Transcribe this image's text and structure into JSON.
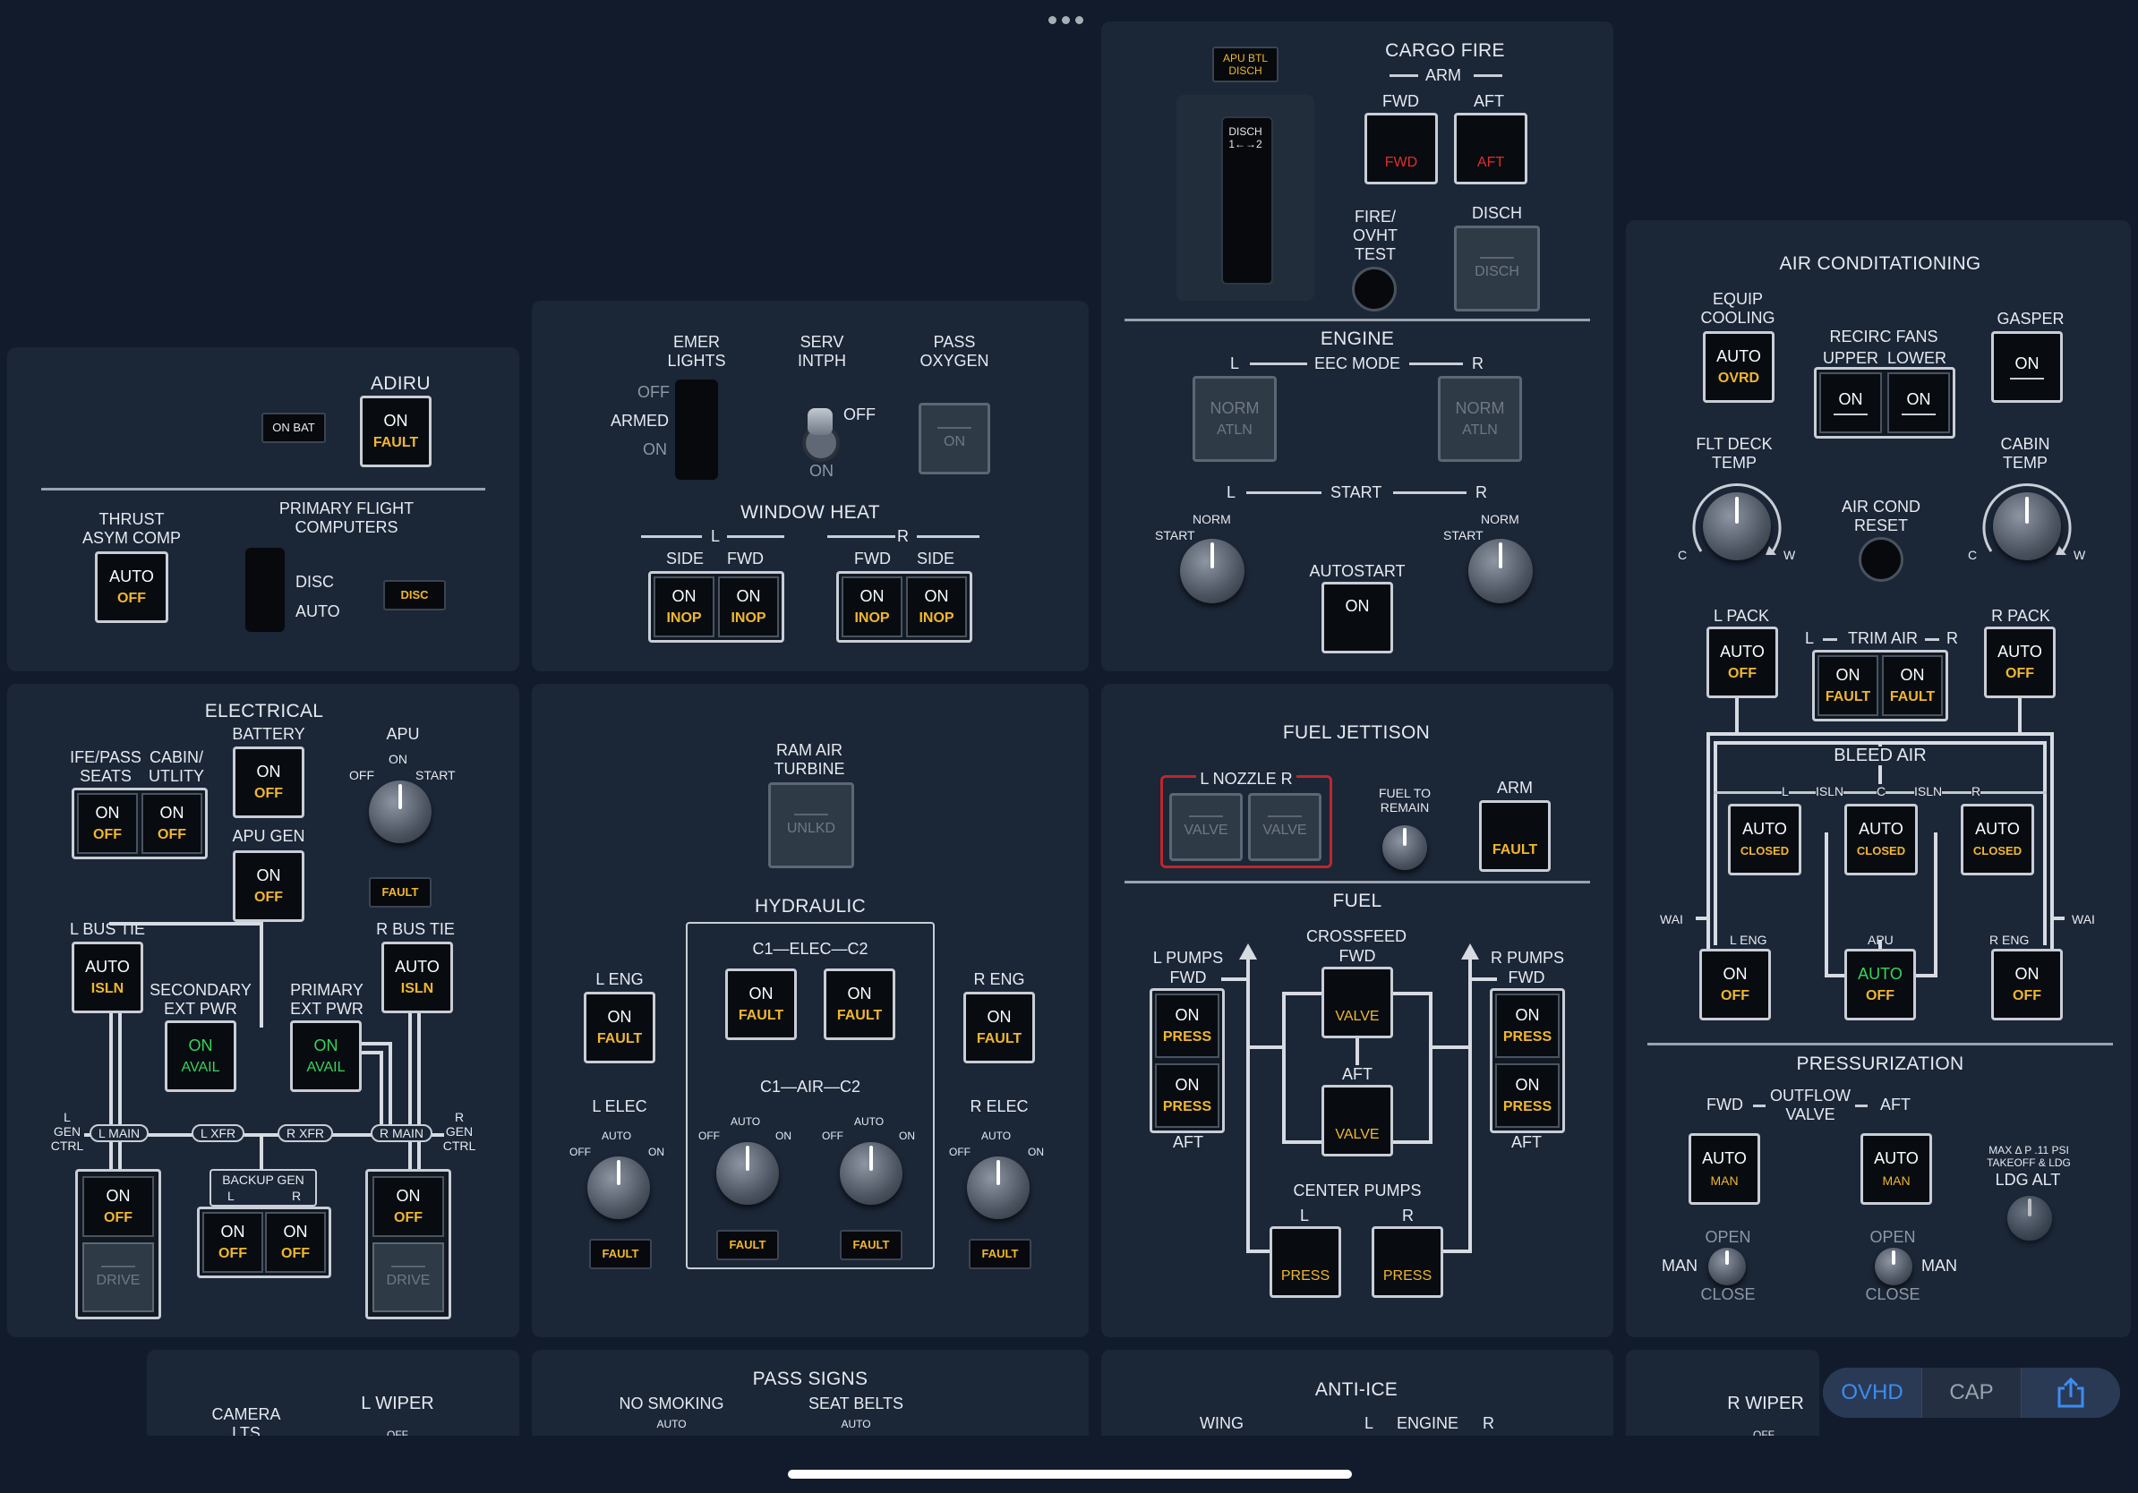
{
  "colors": {
    "background": "#121b2b",
    "panel": "#1b2637",
    "amber": "#f0b630",
    "green": "#39d35c",
    "red": "#e22c2c",
    "accent": "#3d8cf0"
  },
  "adiru": {
    "title": "ADIRU",
    "on_bat": "ON BAT",
    "btn_top": "ON",
    "btn_bot": "FAULT"
  },
  "thrust": {
    "title": "THRUST\nASYM COMP",
    "top": "AUTO",
    "bot": "OFF"
  },
  "pfc": {
    "title": "PRIMARY FLIGHT\nCOMPUTERS",
    "disc": "DISC",
    "auto": "AUTO",
    "lamp": "DISC"
  },
  "emer": {
    "title": "EMER\nLIGHTS",
    "off": "OFF",
    "armed": "ARMED",
    "on": "ON"
  },
  "serv": {
    "title": "SERV\nINTPH",
    "off": "OFF",
    "on": "ON"
  },
  "pass_oxy": {
    "title": "PASS\nOXYGEN",
    "bot": "ON"
  },
  "window_heat": {
    "title": "WINDOW HEAT",
    "l": "L",
    "r": "R",
    "side": "SIDE",
    "fwd": "FWD",
    "on": "ON",
    "inop": "INOP"
  },
  "cargo": {
    "title": "CARGO FIRE",
    "arm": "ARM",
    "fwd": "FWD",
    "aft": "AFT",
    "apu_btl": "APU BTL\nDISCH",
    "disch_slot": "DISCH\n1←→2",
    "fire_test": "FIRE/\nOVHT\nTEST",
    "disch": "DISCH"
  },
  "engine": {
    "title": "ENGINE",
    "eec": "EEC MODE",
    "l": "L",
    "r": "R",
    "norm": "NORM",
    "altn": "ATLN",
    "start": "START",
    "knob_norm": "NORM",
    "knob_start": "START",
    "autostart": "AUTOSTART",
    "on": "ON"
  },
  "aircond": {
    "title": "AIR CONDITATIONING",
    "equip": "EQUIP\nCOOLING",
    "auto": "AUTO",
    "ovrd": "OVRD",
    "recirc": "RECIRC FANS",
    "upper": "UPPER",
    "lower": "LOWER",
    "on": "ON",
    "gasper": "GASPER",
    "flt_deck": "FLT DECK\nTEMP",
    "cabin_temp": "CABIN\nTEMP",
    "c": "C",
    "w": "W",
    "reset": "AIR COND\nRESET",
    "l_pack": "L PACK",
    "r_pack": "R PACK",
    "trim": "TRIM AIR",
    "off": "OFF",
    "fault": "FAULT",
    "l": "L",
    "r": "R"
  },
  "bleed": {
    "title": "BLEED AIR",
    "l": "L",
    "isln": "ISLN",
    "c": "C",
    "r": "R",
    "auto": "AUTO",
    "closed": "CLOSED",
    "wai": "WAI",
    "l_eng": "L ENG",
    "apu": "APU",
    "r_eng": "R ENG",
    "on": "ON",
    "off": "OFF"
  },
  "press": {
    "title": "PRESSURIZATION",
    "fwd": "FWD",
    "aft": "AFT",
    "outflow": "OUTFLOW\nVALVE",
    "auto": "AUTO",
    "man": "MAN",
    "max": "MAX Δ P .11 PSI\nTAKEOFF & LDG",
    "ldg": "LDG ALT",
    "open": "OPEN",
    "close": "CLOSE"
  },
  "electrical": {
    "title": "ELECTRICAL",
    "battery": "BATTERY",
    "ife": "IFE/PASS\nSEATS",
    "cabin": "CABIN/\nUTLITY",
    "apu": "APU",
    "apu_on": "ON",
    "apu_off": "OFF",
    "apu_start": "START",
    "apu_gen": "APU GEN",
    "fault": "FAULT",
    "l_bus": "L BUS TIE",
    "r_bus": "R BUS TIE",
    "auto": "AUTO",
    "isln": "ISLN",
    "sec": "SECONDARY\nEXT PWR",
    "pri": "PRIMARY\nEXT PWR",
    "on": "ON",
    "off": "OFF",
    "avail": "AVAIL",
    "l_gen": "L\nGEN\nCTRL",
    "r_gen": "R\nGEN\nCTRL",
    "l_main": "L MAIN",
    "l_xfr": "L XFR",
    "r_xfr": "R XFR",
    "r_main": "R MAIN",
    "backup": "BACKUP GEN",
    "bl": "L",
    "br": "R",
    "drive": "DRIVE"
  },
  "ram": {
    "title": "RAM AIR\nTURBINE",
    "bot": "UNLKD"
  },
  "hyd": {
    "title": "HYDRAULIC",
    "c1elec": "C1—ELEC—C2",
    "c1air": "C1—AIR—C2",
    "l_eng": "L ENG",
    "r_eng": "R ENG",
    "l_elec": "L ELEC",
    "r_elec": "R ELEC",
    "on": "ON",
    "fault": "FAULT",
    "auto": "AUTO",
    "off": "OFF"
  },
  "jett": {
    "title": "FUEL JETTISON",
    "nozzle": "L NOZZLE R",
    "valve": "VALVE",
    "remain": "FUEL TO\nREMAIN",
    "arm": "ARM",
    "fault": "FAULT"
  },
  "fuel": {
    "title": "FUEL",
    "crossfeed": "CROSSFEED",
    "fwd": "FWD",
    "aft": "AFT",
    "l_pumps": "L PUMPS",
    "r_pumps": "R PUMPS",
    "on": "ON",
    "press": "PRESS",
    "valve": "VALVE",
    "center": "CENTER PUMPS",
    "l": "L",
    "r": "R"
  },
  "bottom": {
    "camera": "CAMERA\nLTS",
    "l_wiper": "L WIPER",
    "pass_signs": "PASS SIGNS",
    "no_smoking": "NO SMOKING",
    "seat_belts": "SEAT BELTS",
    "auto": "AUTO",
    "anti_ice": "ANTI-ICE",
    "wing": "WING",
    "engine": "ENGINE",
    "l": "L",
    "r": "R",
    "r_wiper": "R WIPER",
    "off": "OFF"
  },
  "nav": {
    "ovhd": "OVHD",
    "cap": "CAP"
  }
}
